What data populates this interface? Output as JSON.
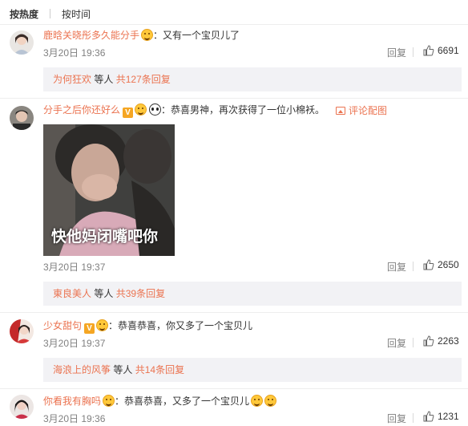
{
  "tabs": [
    {
      "label": "按热度"
    },
    {
      "label": "按时间"
    }
  ],
  "reply_label": "回复",
  "image_comment_label": "评论配图",
  "comments": [
    {
      "user": "鹿晗关晓彤多久能分手",
      "text": "：又有一个宝贝儿了",
      "time": "3月20日 19:36",
      "likes": "6691",
      "replies": {
        "user": "为何狂欢",
        "suffix": "等人",
        "count": "共127条回复"
      }
    },
    {
      "user": "分手之后你还好么",
      "text": "：恭喜男神，再次获得了一位小棉袄。",
      "time": "3月20日 19:37",
      "likes": "2650",
      "gif_caption": "快他妈闭嘴吧你",
      "replies": {
        "user": "東良美人",
        "suffix": "等人",
        "count": "共39条回复"
      }
    },
    {
      "user": "少女甜句",
      "text": "：恭喜恭喜，你又多了一个宝贝儿",
      "time": "3月20日 19:37",
      "likes": "2263",
      "replies": {
        "user": "海浪上的风筝",
        "suffix": "等人",
        "count": "共14条回复"
      }
    },
    {
      "user": "你看我有胸吗",
      "text": "：恭喜恭喜，又多了一个宝贝儿",
      "time": "3月20日 19:36",
      "likes": "1231"
    }
  ],
  "colors": {
    "username": "#eb7350",
    "meta": "#808080",
    "reply_bg": "#f2f2f5"
  }
}
